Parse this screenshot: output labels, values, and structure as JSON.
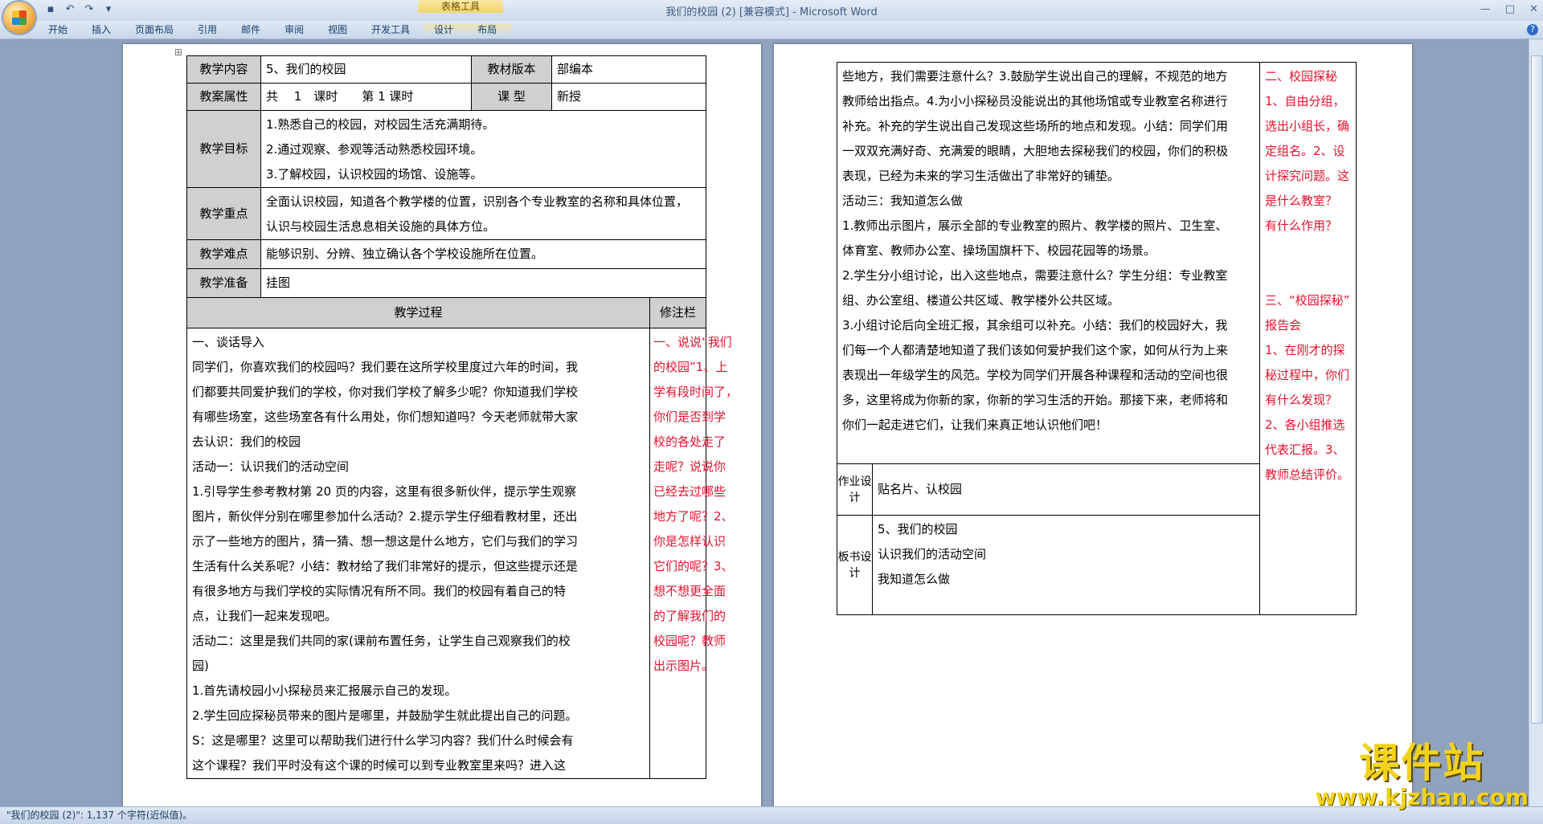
{
  "window": {
    "title": "我们的校园 (2) [兼容模式] - Microsoft Word",
    "context_tab_group": "表格工具",
    "tabs": [
      "开始",
      "插入",
      "页面布局",
      "引用",
      "邮件",
      "审阅",
      "视图",
      "开发工具",
      "设计",
      "布局"
    ]
  },
  "doc": {
    "header_rows": [
      {
        "label": "教学内容",
        "value": "5、我们的校园",
        "label2": "教材版本",
        "value2": "部编本"
      },
      {
        "label": "教案属性",
        "value": "共　 1　课时　　第 1 课时",
        "label2": "课  型",
        "value2": "新授"
      }
    ],
    "goal_label": "教学目标",
    "goals": [
      "1.熟悉自己的校园，对校园生活充满期待。",
      "2.通过观察、参观等活动熟悉校园环境。",
      "3.了解校园，认识校园的场馆、设施等。"
    ],
    "key_label": "教学重点",
    "key_lines": [
      "全面认识校园，知道各个教学楼的位置，识别各个专业教室的名称和具体位置，",
      "认识与校园生活息息相关设施的具体方位。"
    ],
    "difficulty_label": "教学难点",
    "difficulty": "能够识别、分辨、独立确认各个学校设施所在位置。",
    "prep_label": "教学准备",
    "prep": "挂图",
    "process_header": "教学过程",
    "notes_header": "修注栏",
    "process_lines": [
      "一、谈话导入",
      "同学们，你喜欢我们的校园吗？我们要在这所学校里度过六年的时间，我",
      "们都要共同爱护我们的学校，你对我们学校了解多少呢？你知道我们学校",
      "有哪些场室，这些场室各有什么用处，你们想知道吗？今天老师就带大家",
      "去认识：我们的校园",
      "活动一：认识我们的活动空间",
      "1.引导学生参考教材第 20 页的内容，这里有很多新伙伴，提示学生观察",
      "图片，新伙伴分别在哪里参加什么活动？2.提示学生仔细看教材里，还出",
      "示了一些地方的图片，猜一猜、想一想这是什么地方，它们与我们的学习",
      "生活有什么关系呢？小结：教材给了我们非常好的提示，但这些提示还是",
      "有很多地方与我们学校的实际情况有所不同。我们的校园有着自己的特",
      "点，让我们一起来发现吧。",
      "活动二：这里是我们共同的家(课前布置任务，让学生自己观察我们的校",
      "园)",
      "1.首先请校园小小探秘员来汇报展示自己的发现。",
      "2.学生回应探秘员带来的图片是哪里，并鼓励学生就此提出自己的问题。",
      "S：这是哪里？这里可以帮助我们进行什么学习内容？我们什么时候会有",
      "这个课程？我们平时没有这个课的时候可以到专业教室里来吗？进入这"
    ],
    "notes_lines": [
      "一、说说“我们",
      "的校园”1、上",
      "学有段时间了，",
      "你们是否到学",
      "校的各处走了",
      "走呢？说说你",
      "已经去过哪些",
      "地方了呢？2、",
      "你是怎样认识",
      "它们的呢？3、",
      "想不想更全面",
      "的了解我们的",
      "校园呢？教师",
      "出示图片。"
    ],
    "p2_lines": [
      "些地方，我们需要注意什么？3.鼓励学生说出自己的理解，不规范的地方",
      "教师给出指点。4.为小小探秘员没能说出的其他场馆或专业教室名称进行",
      "补充。补充的学生说出自己发现这些场所的地点和发现。小结：同学们用",
      "一双双充满好奇、充满爱的眼睛，大胆地去探秘我们的校园，你们的积极",
      "表现，已经为未来的学习生活做出了非常好的铺垫。",
      "活动三：我知道怎么做",
      "1.教师出示图片，展示全部的专业教室的照片、教学楼的照片、卫生室、",
      "体育室、教师办公室、操场国旗杆下、校园花园等的场景。",
      "2.学生分小组讨论，出入这些地点，需要注意什么？学生分组：专业教室",
      "组、办公室组、楼道公共区域、教学楼外公共区域。",
      "3.小组讨论后向全班汇报，其余组可以补充。小结：我们的校园好大，我",
      "们每一个人都清楚地知道了我们该如何爱护我们这个家，如何从行为上来",
      "表现出一年级学生的风范。学校为同学们开展各种课程和活动的空间也很",
      "多，这里将成为你新的家，你新的学习生活的开始。那接下来，老师将和",
      "你们一起走进它们，让我们来真正地认识他们吧！"
    ],
    "p2_notes_a": [
      "二、校园探秘",
      "1、自由分组，",
      "选出小组长，确",
      "定组名。2、设",
      "计探究问题。这",
      "是什么教室？",
      "有什么作用？"
    ],
    "p2_notes_b": [
      "三、“校园探秘”",
      "报告会",
      "1、在刚才的探",
      "秘过程中，你们",
      "有什么发现？",
      "2、各小组推选",
      "代表汇报。3、",
      "教师总结评价。"
    ],
    "homework_label": "作业设计",
    "homework": "贴名片、认校园",
    "board_label": "板书设计",
    "board_lines": [
      "5、我们的校园",
      "认识我们的活动空间",
      "我知道怎么做"
    ]
  },
  "status": {
    "text": "\"我们的校园 (2)\": 1,137 个字符(近似值)。"
  },
  "watermark": {
    "cn": "课件站",
    "url": "www.kjzhan.com"
  }
}
